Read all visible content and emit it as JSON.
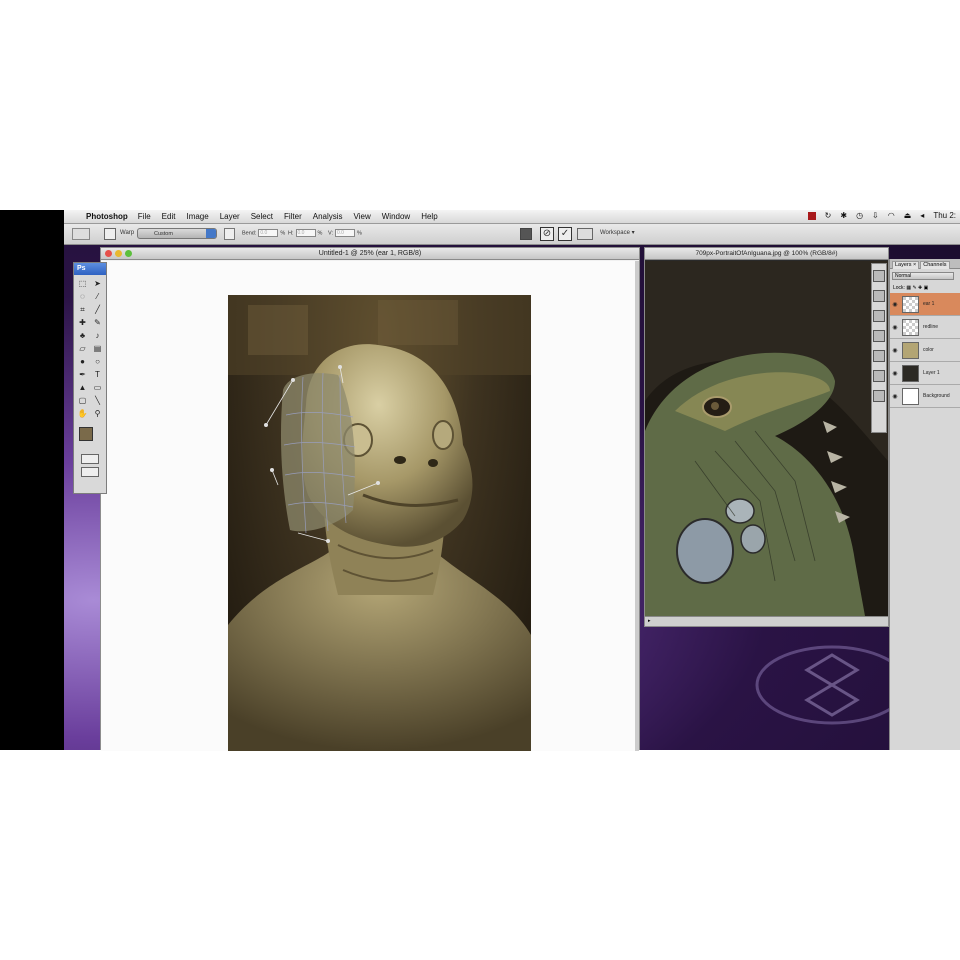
{
  "menubar": {
    "app_name": "Photoshop",
    "items": [
      "File",
      "Edit",
      "Image",
      "Layer",
      "Select",
      "Filter",
      "Analysis",
      "View",
      "Window",
      "Help"
    ],
    "clock": "Thu 2:"
  },
  "options_bar": {
    "warp_label": "Warp",
    "warp_style": "Custom",
    "bend_label": "Bend:",
    "bend_value": "0.0",
    "h_label": "H:",
    "h_value": "0.0",
    "v_label": "V:",
    "v_value": "0.0",
    "percent": "%",
    "workspace_label": "Workspace ▾"
  },
  "tools_panel": {
    "header": "Ps",
    "foreground_color": "#7a6a4a",
    "background_color": "#222222"
  },
  "document_left": {
    "title": "Untitled-1 @ 25% (ear 1, RGB/8)"
  },
  "document_right": {
    "title": "709px-PortraitOfAnIguana.jpg @ 100% (RGB/8#)"
  },
  "layers_panel": {
    "tabs": [
      "Layers ×",
      "Channels"
    ],
    "blend_mode": "Normal",
    "lock_label": "Lock:",
    "layers": [
      {
        "name": "ear 1",
        "selected": true
      },
      {
        "name": "redline",
        "selected": false
      },
      {
        "name": "color",
        "selected": false
      },
      {
        "name": "Layer 1",
        "selected": false
      },
      {
        "name": "Background",
        "selected": false
      }
    ]
  },
  "colors": {
    "selected_layer": "#d9895c",
    "title_bar_blue": "#2f62c2"
  }
}
